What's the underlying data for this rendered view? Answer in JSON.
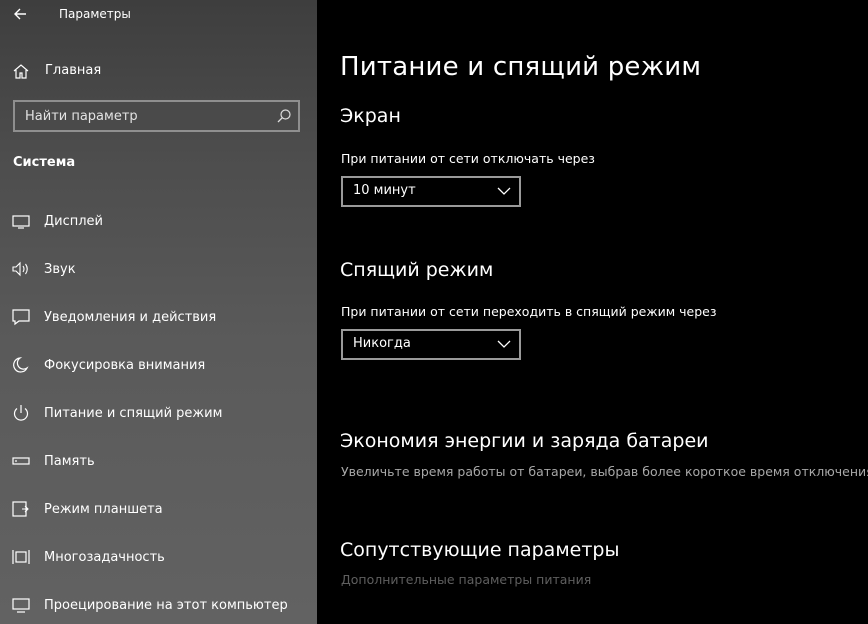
{
  "window": {
    "title": "Параметры"
  },
  "sidebar": {
    "home_label": "Главная",
    "search": {
      "placeholder": "Найти параметр"
    },
    "section_title": "Система",
    "items": [
      {
        "label": "Дисплей",
        "icon": "display-icon"
      },
      {
        "label": "Звук",
        "icon": "speaker-icon"
      },
      {
        "label": "Уведомления и действия",
        "icon": "notification-icon"
      },
      {
        "label": "Фокусировка внимания",
        "icon": "moon-icon"
      },
      {
        "label": "Питание и спящий режим",
        "icon": "power-icon",
        "selected": true
      },
      {
        "label": "Память",
        "icon": "storage-icon"
      },
      {
        "label": "Режим планшета",
        "icon": "tablet-icon"
      },
      {
        "label": "Многозадачность",
        "icon": "multitask-icon"
      },
      {
        "label": "Проецирование на этот компьютер",
        "icon": "project-icon"
      }
    ]
  },
  "main": {
    "title": "Питание и спящий режим",
    "screen": {
      "heading": "Экран",
      "label": "При питании от сети отключать через",
      "value": "10 минут"
    },
    "sleep": {
      "heading": "Спящий режим",
      "label": "При питании от сети переходить в спящий режим через",
      "value": "Никогда"
    },
    "saver": {
      "heading": "Экономия энергии и заряда батареи",
      "description": "Увеличьте время работы от батареи, выбрав более короткое время отключения э"
    },
    "related": {
      "heading": "Сопутствующие параметры",
      "link": "Дополнительные параметры питания"
    }
  },
  "colors": {
    "sidebar_bg": "#555555",
    "main_bg": "#000000",
    "link_disabled": "#5f5f5f"
  }
}
